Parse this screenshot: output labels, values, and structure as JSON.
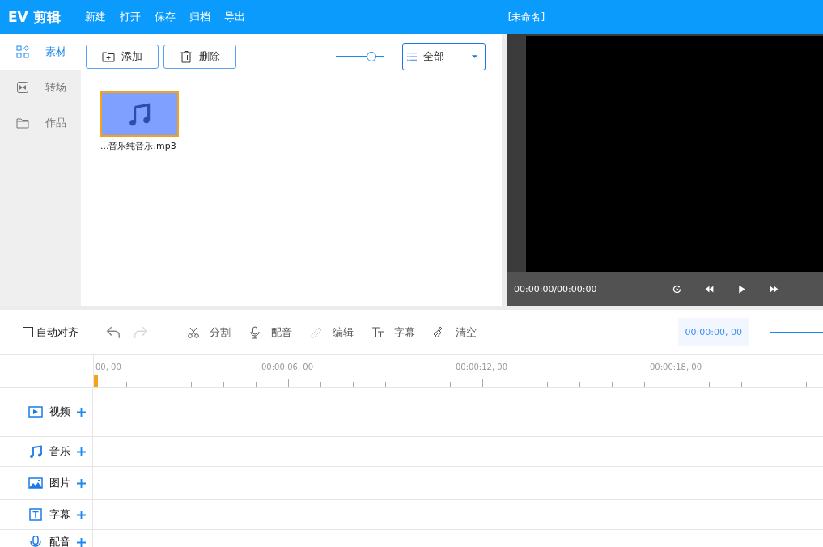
{
  "app": {
    "logo": "EV 剪辑",
    "menu": [
      "新建",
      "打开",
      "保存",
      "归档",
      "导出"
    ],
    "document_title": "[未命名]"
  },
  "sidebar": {
    "items": [
      {
        "label": "素材",
        "kind": "assets",
        "selected": true
      },
      {
        "label": "转场",
        "kind": "transition",
        "selected": false
      },
      {
        "label": "作品",
        "kind": "folder",
        "selected": false
      }
    ]
  },
  "library": {
    "buttons": [
      {
        "label": "添加",
        "kind": "add"
      },
      {
        "label": "删除",
        "kind": "delete"
      }
    ],
    "size_slider": {
      "level": 0.73
    },
    "filter": {
      "value": "全部"
    },
    "items": [
      {
        "name": "...音乐纯音乐.mp3",
        "selected": true
      }
    ]
  },
  "preview": {
    "time": "00:00:00/00:00:00"
  },
  "toolbar": {
    "auto_align": {
      "label": "自动对齐",
      "checked": false
    },
    "tools": [
      {
        "kind": "undo",
        "disabled": false
      },
      {
        "kind": "redo",
        "disabled": true
      },
      {
        "kind": "split",
        "label": "分割",
        "disabled": false
      },
      {
        "kind": "voice",
        "label": "配音",
        "disabled": false
      },
      {
        "kind": "edit",
        "label": "编辑",
        "disabled": true
      },
      {
        "kind": "text",
        "label": "字幕",
        "disabled": false
      },
      {
        "kind": "clear",
        "label": "清空",
        "disabled": false
      }
    ],
    "timecode": "00:00:00, 00"
  },
  "ruler": {
    "labels": [
      "00, 00",
      "00:00:06, 00",
      "00:00:12, 00",
      "00:00:18, 00"
    ]
  },
  "tracks": [
    {
      "kind": "video",
      "label": "视频"
    },
    {
      "kind": "music",
      "label": "音乐"
    },
    {
      "kind": "image",
      "label": "图片"
    },
    {
      "kind": "text",
      "label": "字幕"
    },
    {
      "kind": "voice",
      "label": "配音"
    }
  ]
}
